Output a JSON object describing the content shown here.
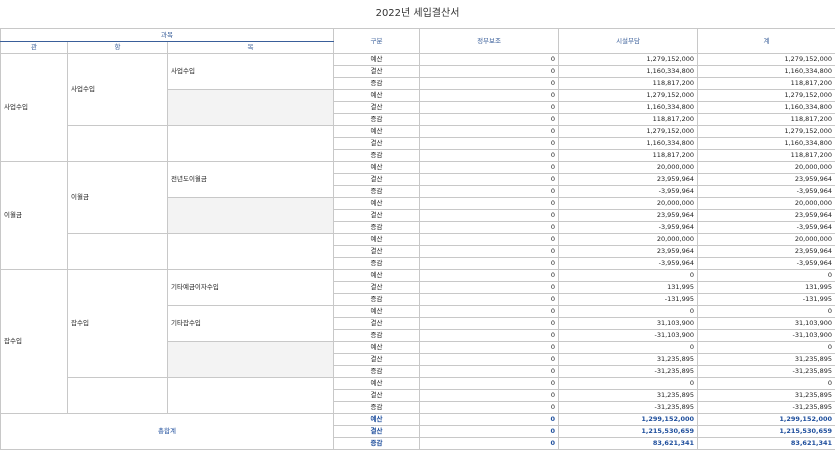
{
  "title": "2022년 세입결산서",
  "headers": {
    "group": "과목",
    "gwan": "관",
    "hang": "항",
    "mok": "목",
    "gubun": "구분",
    "col1": "정부보조",
    "col2": "시설부담",
    "col3": "계"
  },
  "labels": {
    "gwan_saeop": "사업수입",
    "hang_saeop": "사업수입",
    "mok_saeop": "사업수입",
    "gwan_iwol": "이월금",
    "hang_iwol": "이월금",
    "mok_iwol": "전년도이월금",
    "gwan_jap": "잡수입",
    "hang_jap": "잡수입",
    "mok_jap1": "기타예금이자수입",
    "mok_jap2": "기타잡수입",
    "total": "총합계"
  },
  "rows": [
    {
      "g": "예산",
      "a": "0",
      "b": "1,279,152,000",
      "c": "1,279,152,000"
    },
    {
      "g": "결산",
      "a": "0",
      "b": "1,160,334,800",
      "c": "1,160,334,800"
    },
    {
      "g": "증감",
      "a": "0",
      "b": "118,817,200",
      "c": "118,817,200"
    },
    {
      "g": "예산",
      "a": "0",
      "b": "1,279,152,000",
      "c": "1,279,152,000"
    },
    {
      "g": "결산",
      "a": "0",
      "b": "1,160,334,800",
      "c": "1,160,334,800"
    },
    {
      "g": "증감",
      "a": "0",
      "b": "118,817,200",
      "c": "118,817,200"
    },
    {
      "g": "예산",
      "a": "0",
      "b": "1,279,152,000",
      "c": "1,279,152,000"
    },
    {
      "g": "결산",
      "a": "0",
      "b": "1,160,334,800",
      "c": "1,160,334,800"
    },
    {
      "g": "증감",
      "a": "0",
      "b": "118,817,200",
      "c": "118,817,200"
    },
    {
      "g": "예산",
      "a": "0",
      "b": "20,000,000",
      "c": "20,000,000"
    },
    {
      "g": "결산",
      "a": "0",
      "b": "23,959,964",
      "c": "23,959,964"
    },
    {
      "g": "증감",
      "a": "0",
      "b": "-3,959,964",
      "c": "-3,959,964"
    },
    {
      "g": "예산",
      "a": "0",
      "b": "20,000,000",
      "c": "20,000,000"
    },
    {
      "g": "결산",
      "a": "0",
      "b": "23,959,964",
      "c": "23,959,964"
    },
    {
      "g": "증감",
      "a": "0",
      "b": "-3,959,964",
      "c": "-3,959,964"
    },
    {
      "g": "예산",
      "a": "0",
      "b": "20,000,000",
      "c": "20,000,000"
    },
    {
      "g": "결산",
      "a": "0",
      "b": "23,959,964",
      "c": "23,959,964"
    },
    {
      "g": "증감",
      "a": "0",
      "b": "-3,959,964",
      "c": "-3,959,964"
    },
    {
      "g": "예산",
      "a": "0",
      "b": "0",
      "c": "0"
    },
    {
      "g": "결산",
      "a": "0",
      "b": "131,995",
      "c": "131,995"
    },
    {
      "g": "증감",
      "a": "0",
      "b": "-131,995",
      "c": "-131,995"
    },
    {
      "g": "예산",
      "a": "0",
      "b": "0",
      "c": "0"
    },
    {
      "g": "결산",
      "a": "0",
      "b": "31,103,900",
      "c": "31,103,900"
    },
    {
      "g": "증감",
      "a": "0",
      "b": "-31,103,900",
      "c": "-31,103,900"
    },
    {
      "g": "예산",
      "a": "0",
      "b": "0",
      "c": "0"
    },
    {
      "g": "결산",
      "a": "0",
      "b": "31,235,895",
      "c": "31,235,895"
    },
    {
      "g": "증감",
      "a": "0",
      "b": "-31,235,895",
      "c": "-31,235,895"
    },
    {
      "g": "예산",
      "a": "0",
      "b": "0",
      "c": "0"
    },
    {
      "g": "결산",
      "a": "0",
      "b": "31,235,895",
      "c": "31,235,895"
    },
    {
      "g": "증감",
      "a": "0",
      "b": "-31,235,895",
      "c": "-31,235,895"
    },
    {
      "g": "예산",
      "a": "0",
      "b": "1,299,152,000",
      "c": "1,299,152,000"
    },
    {
      "g": "결산",
      "a": "0",
      "b": "1,215,530,659",
      "c": "1,215,530,659"
    },
    {
      "g": "증감",
      "a": "0",
      "b": "83,621,341",
      "c": "83,621,341"
    }
  ]
}
